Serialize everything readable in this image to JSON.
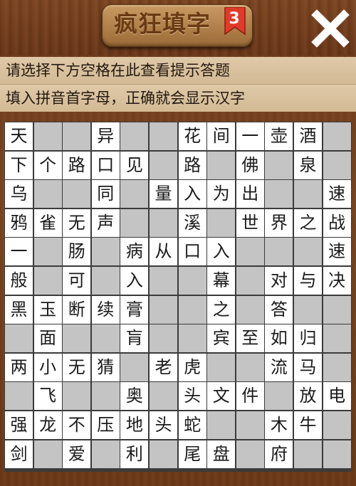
{
  "header": {
    "title": "疯狂填字",
    "level": "3",
    "close_label": "✕",
    "colors": {
      "badge": "#e23a2a",
      "plaque": "#b88a54"
    }
  },
  "hints": {
    "line1": "请选择下方空格在此查看提示答题",
    "line2": "填入拼音首字母，正确就会显示汉字"
  },
  "grid": {
    "rows": [
      [
        "天",
        "",
        "",
        "异",
        "",
        "",
        "花",
        "间",
        "一",
        "壶",
        "酒",
        ""
      ],
      [
        "下",
        "个",
        "路",
        "口",
        "见",
        "",
        "路",
        "",
        "佛",
        "",
        "泉",
        ""
      ],
      [
        "乌",
        "",
        "",
        "同",
        "",
        "量",
        "入",
        "为",
        "出",
        "",
        "",
        "速"
      ],
      [
        "鸦",
        "雀",
        "无",
        "声",
        "",
        "",
        "溪",
        "",
        "世",
        "界",
        "之",
        "战"
      ],
      [
        "一",
        "",
        "肠",
        "",
        "病",
        "从",
        "口",
        "入",
        "",
        "",
        "",
        "速"
      ],
      [
        "般",
        "",
        "可",
        "",
        "入",
        "",
        "",
        "幕",
        "",
        "对",
        "与",
        "决"
      ],
      [
        "黑",
        "玉",
        "断",
        "续",
        "膏",
        "",
        "",
        "之",
        "",
        "答",
        "",
        ""
      ],
      [
        "",
        "面",
        "",
        "",
        "肓",
        "",
        "",
        "宾",
        "至",
        "如",
        "归",
        ""
      ],
      [
        "两",
        "小",
        "无",
        "猜",
        "",
        "老",
        "虎",
        "",
        "",
        "流",
        "马",
        ""
      ],
      [
        "",
        "飞",
        "",
        "",
        "奥",
        "",
        "头",
        "文",
        "件",
        "",
        "放",
        "电"
      ],
      [
        "强",
        "龙",
        "不",
        "压",
        "地",
        "头",
        "蛇",
        "",
        "",
        "木",
        "牛",
        ""
      ],
      [
        "剑",
        "",
        "爱",
        "",
        "利",
        "",
        "尾",
        "盘",
        "",
        "府",
        "",
        ""
      ]
    ],
    "cell_types": [
      "LBBLBBLLLLLB",
      "LLLLLBLBLBLB",
      "LBBLBLLLLBBL",
      "LLLLBBLBLLLL",
      "LBLBLLLLBBBL",
      "LBLBLBBLBLLL",
      "LLLLLBBLBLBB",
      "BLBBLBBLLLLB",
      "LLLLBLLBBLLB",
      "BLBBLBLLLBLL",
      "LLLLLLLBBLLB",
      "LBLBLBLLBLBB"
    ],
    "colors": {
      "letter": "#ffffff",
      "blank": "#c4c4c4",
      "grid_line": "#3b3b3b"
    }
  }
}
